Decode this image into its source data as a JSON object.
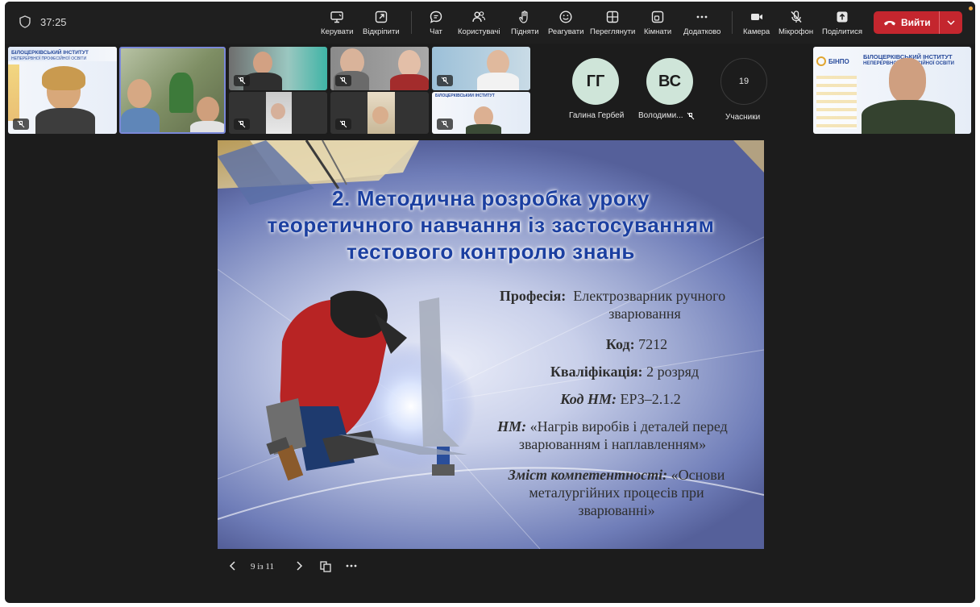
{
  "meeting": {
    "timer": "37:25"
  },
  "toolbar": {
    "items": [
      {
        "label": "Керувати",
        "icon": "share-screen-icon"
      },
      {
        "label": "Відкріпити",
        "icon": "pop-out-icon"
      },
      {
        "label": "Чат",
        "icon": "chat-icon"
      },
      {
        "label": "Користувачі",
        "icon": "people-icon"
      },
      {
        "label": "Підняти",
        "icon": "raise-hand-icon"
      },
      {
        "label": "Реагувати",
        "icon": "smiley-icon"
      },
      {
        "label": "Переглянути",
        "icon": "grid-view-icon"
      },
      {
        "label": "Кімнати",
        "icon": "rooms-icon"
      },
      {
        "label": "Додатково",
        "icon": "more-icon"
      },
      {
        "label": "Камера",
        "icon": "camera-icon"
      },
      {
        "label": "Мікрофон",
        "icon": "mic-off-icon"
      },
      {
        "label": "Поділитися",
        "icon": "share-icon"
      }
    ],
    "leave_label": "Вийти",
    "leave_color": "#c4262e"
  },
  "participants": {
    "avatars": [
      {
        "initials": "ГГ",
        "name": "Галина Гербей"
      },
      {
        "initials": "ВС",
        "name": "Володими..."
      }
    ],
    "count": "19",
    "count_label": "Учасники",
    "banner_text_1": "БІЛОЦЕРКІВСЬКИЙ ІНСТИТУТ",
    "banner_text_2": "НЕПЕРЕРВНОЇ ПРОФЕСІЙНОЇ ОСВІТИ",
    "banner_logo": "БІНПО"
  },
  "slide": {
    "title_lines": [
      "2. Методична розробка уроку",
      "теоретичного навчання із застосуванням",
      "тестового контролю знань"
    ],
    "profession_label": "Професія:",
    "profession_value_1": "Електрозварник ручного",
    "profession_value_2": "зварювання",
    "code_label": "Код:",
    "code_value": "7212",
    "qual_label": "Кваліфікація:",
    "qual_value": "2 розряд",
    "nm_code_label": "Код НМ:",
    "nm_code_value": "ЕРЗ–2.1.2",
    "nm_label": "НМ:",
    "nm_value_1": "«Нагрів виробів і деталей перед",
    "nm_value_2": "зварюванням і наплавленням»",
    "comp_label": "Зміст компетентності:",
    "comp_value_1": "«Основи",
    "comp_value_2": "металургійних процесів при",
    "comp_value_3": "зварюванні»"
  },
  "slide_controls": {
    "page": "9 із 11"
  },
  "colors": {
    "accent_title": "#1b3fa0",
    "avatar_bg": "#cfe5d9",
    "app_bg": "#1c1c1c"
  }
}
